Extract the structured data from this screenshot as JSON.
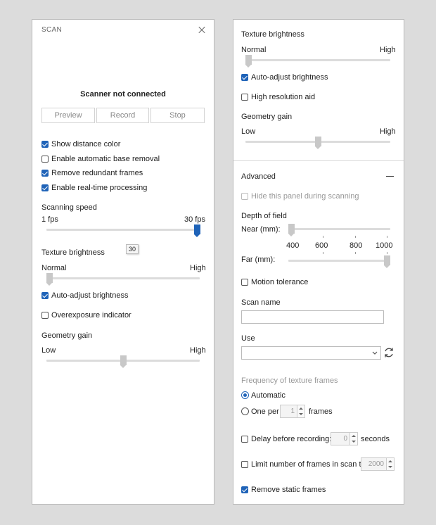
{
  "left": {
    "title": "SCAN",
    "status": "Scanner not connected",
    "buttons": {
      "preview": "Preview",
      "record": "Record",
      "stop": "Stop"
    },
    "checkboxes": [
      {
        "label": "Show distance color",
        "checked": true
      },
      {
        "label": "Enable automatic base removal",
        "checked": false
      },
      {
        "label": "Remove redundant frames",
        "checked": true
      },
      {
        "label": "Enable real-time processing",
        "checked": true
      }
    ],
    "scanning_speed": {
      "label": "Scanning speed",
      "min_label": "1 fps",
      "max_label": "30 fps",
      "value": 30,
      "tooltip": "30"
    },
    "texture_brightness": {
      "label": "Texture brightness",
      "min_label": "Normal",
      "max_label": "High",
      "level": 0
    },
    "auto_adjust": {
      "label": "Auto-adjust brightness",
      "checked": true
    },
    "overexposure": {
      "label": "Overexposure indicator",
      "checked": false
    },
    "geometry_gain": {
      "label": "Geometry gain",
      "min_label": "Low",
      "max_label": "High",
      "level": 0.5
    }
  },
  "right": {
    "texture_brightness": {
      "label": "Texture brightness",
      "min_label": "Normal",
      "max_label": "High",
      "level": 0
    },
    "auto_adjust": {
      "label": "Auto-adjust brightness",
      "checked": true
    },
    "high_res": {
      "label": "High resolution aid",
      "checked": false
    },
    "geometry_gain": {
      "label": "Geometry gain",
      "min_label": "Low",
      "max_label": "High",
      "level": 0.5
    },
    "advanced": {
      "label": "Advanced",
      "hide_panel": {
        "label": "Hide this panel during scanning",
        "checked": false
      },
      "depth_of_field": {
        "label": "Depth of field",
        "near_label": "Near (mm):",
        "far_label": "Far (mm):",
        "ticks": [
          "400",
          "600",
          "800",
          "1000"
        ]
      },
      "motion_tolerance": {
        "label": "Motion tolerance",
        "checked": false
      },
      "scan_name": {
        "label": "Scan name",
        "value": ""
      },
      "use": {
        "label": "Use",
        "value": ""
      },
      "frequency": {
        "label": "Frequency of texture frames",
        "automatic": "Automatic",
        "one_per": "One per",
        "one_per_value": "1",
        "frames_unit": "frames"
      },
      "delay": {
        "label": "Delay before recording:",
        "value": "0",
        "unit": "seconds",
        "checked": false
      },
      "limit": {
        "label": "Limit number of frames in scan to",
        "value": "2000",
        "checked": false
      },
      "remove_static": {
        "label": "Remove static frames",
        "checked": true
      }
    }
  }
}
